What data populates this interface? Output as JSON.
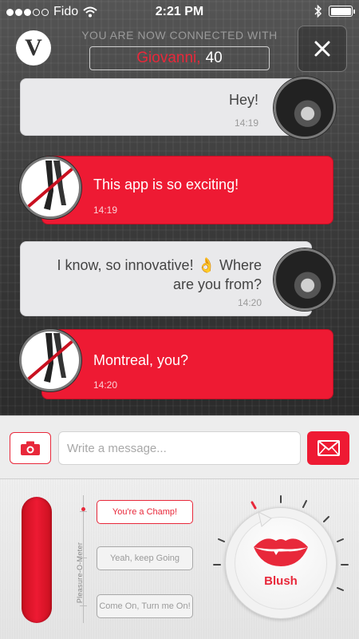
{
  "status_bar": {
    "carrier": "Fido",
    "time": "2:21 PM"
  },
  "header": {
    "logo_letter": "V",
    "connected_label": "YOU ARE NOW CONNECTED WITH",
    "match_name": "Giovanni,",
    "match_age": "40",
    "close_label": "✕"
  },
  "messages": [
    {
      "sender": "them",
      "text": "Hey!",
      "time": "14:19"
    },
    {
      "sender": "me",
      "text": "This app is so exciting!",
      "time": "14:19"
    },
    {
      "sender": "them",
      "text_line1": "I know, so innovative! 👌 Where",
      "text_line2": "are you from?",
      "time": "14:20"
    },
    {
      "sender": "me",
      "text": "Montreal, you?",
      "time": "14:20"
    }
  ],
  "composer": {
    "placeholder": "Write a message..."
  },
  "meter": {
    "axis_label": "Pleasure-O-Meter",
    "levels": [
      {
        "label": "You're a Champ!",
        "active": true
      },
      {
        "label": "Yeah, keep Going",
        "active": false
      },
      {
        "label": "Come On, Turn me On!",
        "active": false
      }
    ],
    "dial_label": "Blush"
  },
  "colors": {
    "accent": "#ee1a33",
    "bubble_them": "#e9e9eb",
    "bubble_me": "#ee1a33"
  },
  "icons": [
    "wifi-icon",
    "bluetooth-icon",
    "battery-icon",
    "close-icon",
    "camera-icon",
    "envelope-icon",
    "lips-icon"
  ]
}
